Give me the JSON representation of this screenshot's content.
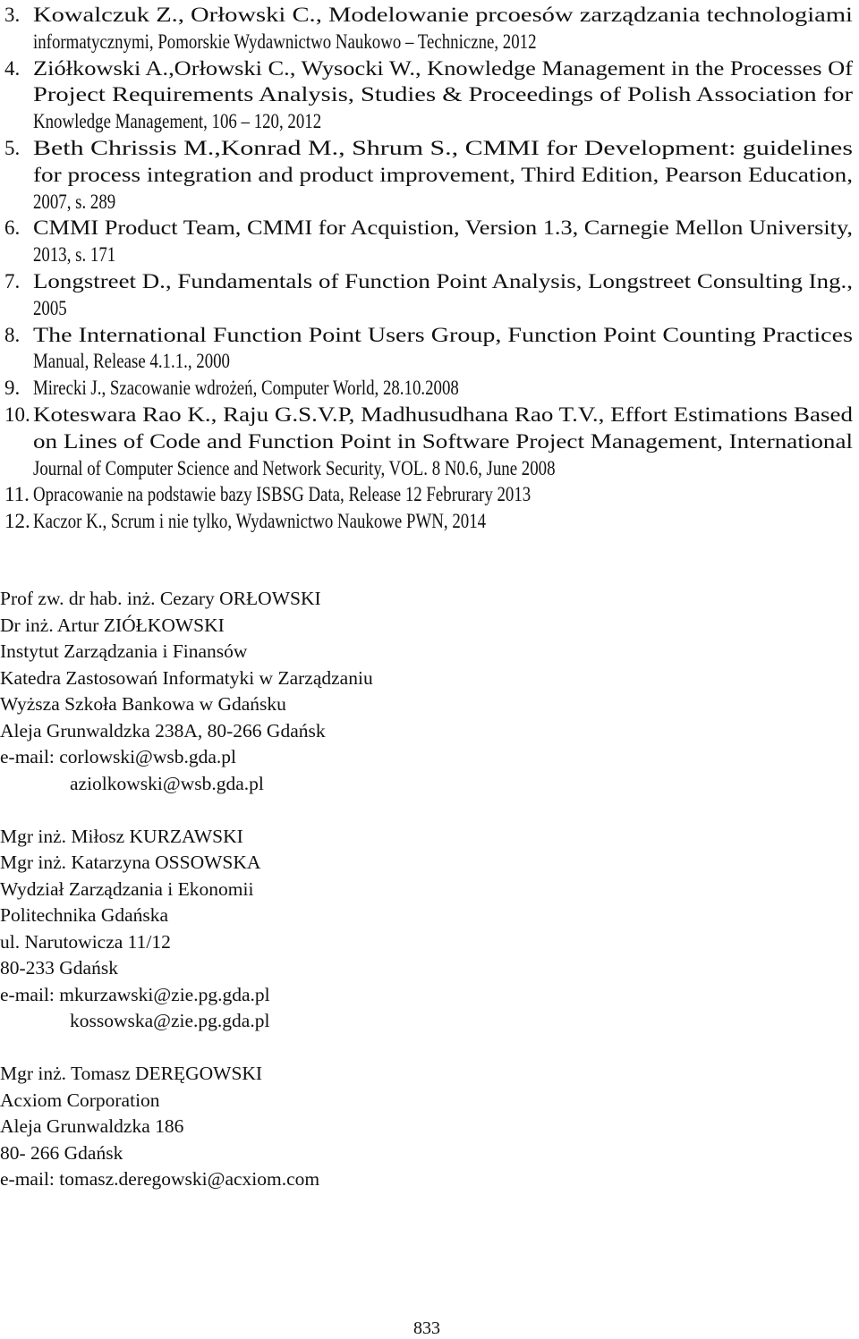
{
  "references": [
    {
      "num": "3.",
      "lines": [
        "Kowalczuk Z.,  Orłowski C., Modelowanie prcoesów zarządzania technologiami",
        "informatycznymi, Pomorskie Wydawnictwo Naukowo – Techniczne, 2012"
      ]
    },
    {
      "num": "4.",
      "lines": [
        "Ziółkowski A.,Orłowski C., Wysocki W., Knowledge Management in the Processes Of",
        "Project Requirements Analysis, Studies & Proceedings of Polish Association for",
        "Knowledge Management, 106 – 120, 2012"
      ]
    },
    {
      "num": "5.",
      "lines": [
        "Beth Chrissis M.,Konrad M., Shrum S., CMMI for Development: guidelines",
        "for process integration and product improvement, Third Edition, Pearson Education,",
        "2007, s. 289"
      ]
    },
    {
      "num": "6.",
      "lines": [
        "CMMI Product Team, CMMI for Acquistion, Version 1.3, Carnegie Mellon University,",
        "2013, s. 171"
      ]
    },
    {
      "num": "7.",
      "lines": [
        "Longstreet D., Fundamentals of Function Point Analysis, Longstreet Consulting Ing.,",
        "2005"
      ]
    },
    {
      "num": "8.",
      "lines": [
        "The International Function Point Users Group, Function Point Counting Practices",
        "Manual, Release 4.1.1., 2000"
      ]
    },
    {
      "num": "9.",
      "lines": [
        "Mirecki J., Szacowanie wdrożeń, Computer World, 28.10.2008"
      ]
    },
    {
      "num": "10.",
      "lines": [
        "Koteswara Rao K., Raju G.S.V.P, Madhusudhana Rao T.V., Effort Estimations Based",
        "on Lines of Code and Function Point in Software Project Management, International",
        "Journal of Computer Science and Network Security, VOL. 8 N0.6, June 2008"
      ]
    },
    {
      "num": "11.",
      "lines": [
        "Opracowanie na podstawie bazy ISBSG Data, Release 12 Februrary 2013"
      ]
    },
    {
      "num": "12.",
      "lines": [
        "Kaczor K., Scrum i nie tylko, Wydawnictwo Naukowe PWN, 2014"
      ]
    }
  ],
  "authors": [
    {
      "lines": [
        "Prof zw. dr hab. inż. Cezary ORŁOWSKI",
        "Dr inż. Artur ZIÓŁKOWSKI",
        "Instytut Zarządzania i Finansów",
        "Katedra Zastosowań Informatyki w Zarządzaniu",
        "Wyższa Szkoła Bankowa w Gdańsku",
        "Aleja Grunwaldzka 238A, 80-266 Gdańsk",
        "e-mail: corlowski@wsb.gda.pl"
      ],
      "extra_emails": [
        "aziolkowski@wsb.gda.pl"
      ]
    },
    {
      "lines": [
        "Mgr inż. Miłosz KURZAWSKI",
        "Mgr inż. Katarzyna OSSOWSKA",
        "Wydział Zarządzania i Ekonomii",
        "Politechnika Gdańska",
        "ul. Narutowicza 11/12",
        "80-233 Gdańsk",
        "e-mail: mkurzawski@zie.pg.gda.pl"
      ],
      "extra_emails": [
        "kossowska@zie.pg.gda.pl"
      ]
    },
    {
      "lines": [
        "Mgr inż. Tomasz DERĘGOWSKI",
        "Acxiom Corporation",
        "Aleja Grunwaldzka 186",
        "80- 266 Gdańsk",
        "e-mail: tomasz.deregowski@acxiom.com"
      ],
      "extra_emails": []
    }
  ],
  "page_number": "833"
}
